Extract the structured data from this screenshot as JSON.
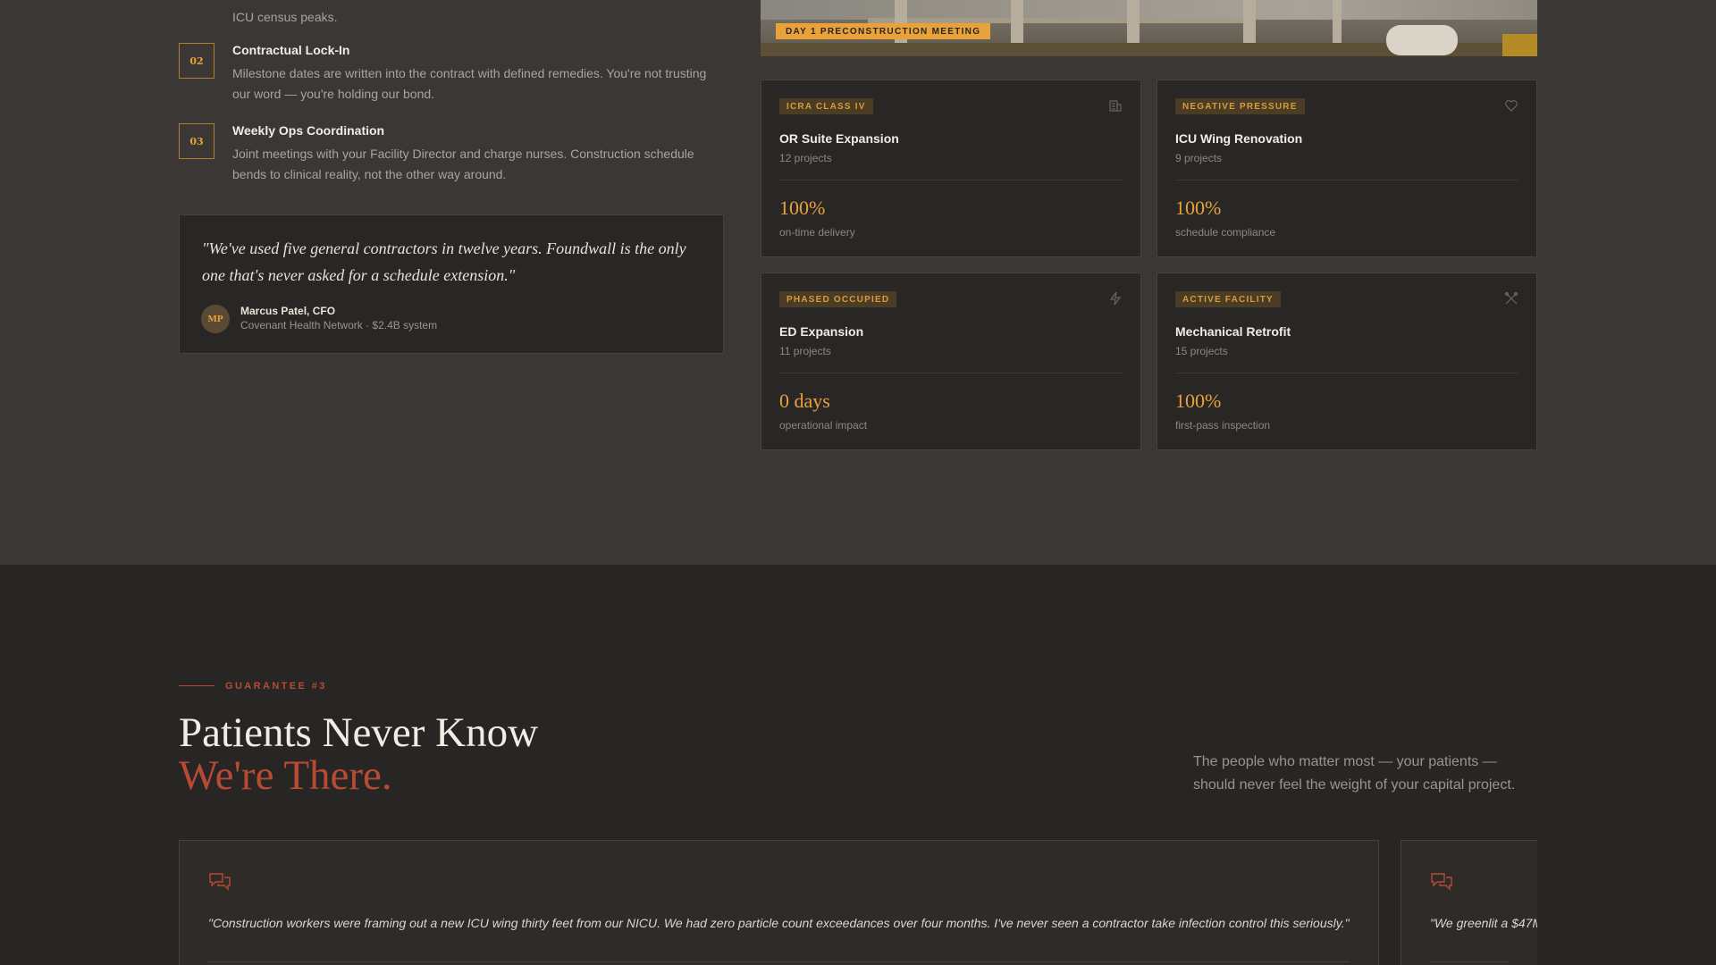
{
  "steps": {
    "partial_desc": "ICU census peaks.",
    "items": [
      {
        "num": "02",
        "title": "Contractual Lock-In",
        "desc": "Milestone dates are written into the contract with defined remedies. You're not trusting our word — you're holding our bond."
      },
      {
        "num": "03",
        "title": "Weekly Ops Coordination",
        "desc": "Joint meetings with your Facility Director and charge nurses. Construction schedule bends to clinical reality, not the other way around."
      }
    ]
  },
  "quote": {
    "text": "\"We've used five general contractors in twelve years. Foundwall is the only one that's never asked for a schedule extension.\"",
    "initials": "MP",
    "name": "Marcus Patel, CFO",
    "org": "Covenant Health Network · $2.4B system"
  },
  "photo": {
    "badge": "DAY 1 PRECONSTRUCTION MEETING"
  },
  "projects": [
    {
      "tag": "ICRA CLASS IV",
      "icon": "building-icon",
      "name": "OR Suite Expansion",
      "count": "12 projects",
      "stat": "100%",
      "stat_label": "on-time delivery"
    },
    {
      "tag": "NEGATIVE PRESSURE",
      "icon": "heart-icon",
      "name": "ICU Wing Renovation",
      "count": "9 projects",
      "stat": "100%",
      "stat_label": "schedule compliance"
    },
    {
      "tag": "PHASED OCCUPIED",
      "icon": "lightning-icon",
      "name": "ED Expansion",
      "count": "11 projects",
      "stat": "0 days",
      "stat_label": "operational impact"
    },
    {
      "tag": "ACTIVE FACILITY",
      "icon": "tools-icon",
      "name": "Mechanical Retrofit",
      "count": "15 projects",
      "stat": "100%",
      "stat_label": "first-pass inspection"
    }
  ],
  "guarantee": {
    "eyebrow": "GUARANTEE #3",
    "headline_line1": "Patients Never Know",
    "headline_line2": "We're There.",
    "intro": "The people who matter most — your patients — should never feel the weight of your capital project."
  },
  "testimonials": [
    {
      "icon": "chat-bubbles-icon",
      "text": "\"Construction workers were framing out a new ICU wing thirty feet from our NICU. We had zero particle count exceedances over four months. I've never seen a contractor take infection control this seriously.\""
    },
    {
      "icon": "chat-bubbles-icon",
      "text": "\"We greenlit a $47M"
    }
  ],
  "colors": {
    "accent_amber": "#e9a23b",
    "accent_red": "#b84a34",
    "bg_top": "#3a3735",
    "bg_bottom": "#282625",
    "card_bg": "#292726"
  }
}
